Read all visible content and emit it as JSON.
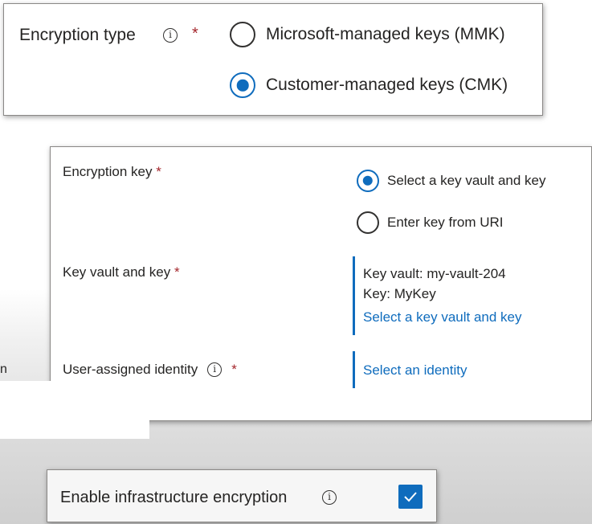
{
  "encryption_type": {
    "label": "Encryption type",
    "required_mark": "*",
    "options": [
      {
        "label": "Microsoft-managed keys (MMK)",
        "selected": false
      },
      {
        "label": "Customer-managed keys (CMK)",
        "selected": true
      }
    ]
  },
  "encryption_key": {
    "label": "Encryption key",
    "required_mark": "*",
    "options": [
      {
        "label": "Select a key vault and key",
        "selected": true
      },
      {
        "label": "Enter key from URI",
        "selected": false
      }
    ]
  },
  "key_vault_and_key": {
    "label": "Key vault and key",
    "required_mark": "*",
    "vault_text": "Key vault: my-vault-204",
    "key_text": "Key: MyKey",
    "link": "Select a key vault and key"
  },
  "user_assigned_identity": {
    "label": "User-assigned identity",
    "required_mark": "*",
    "link": "Select an identity"
  },
  "infrastructure_encryption": {
    "label": "Enable infrastructure encryption",
    "checked": true
  },
  "stray_text": "n",
  "colors": {
    "accent": "#0f6cbd",
    "required": "#a4262c",
    "text": "#252423"
  }
}
